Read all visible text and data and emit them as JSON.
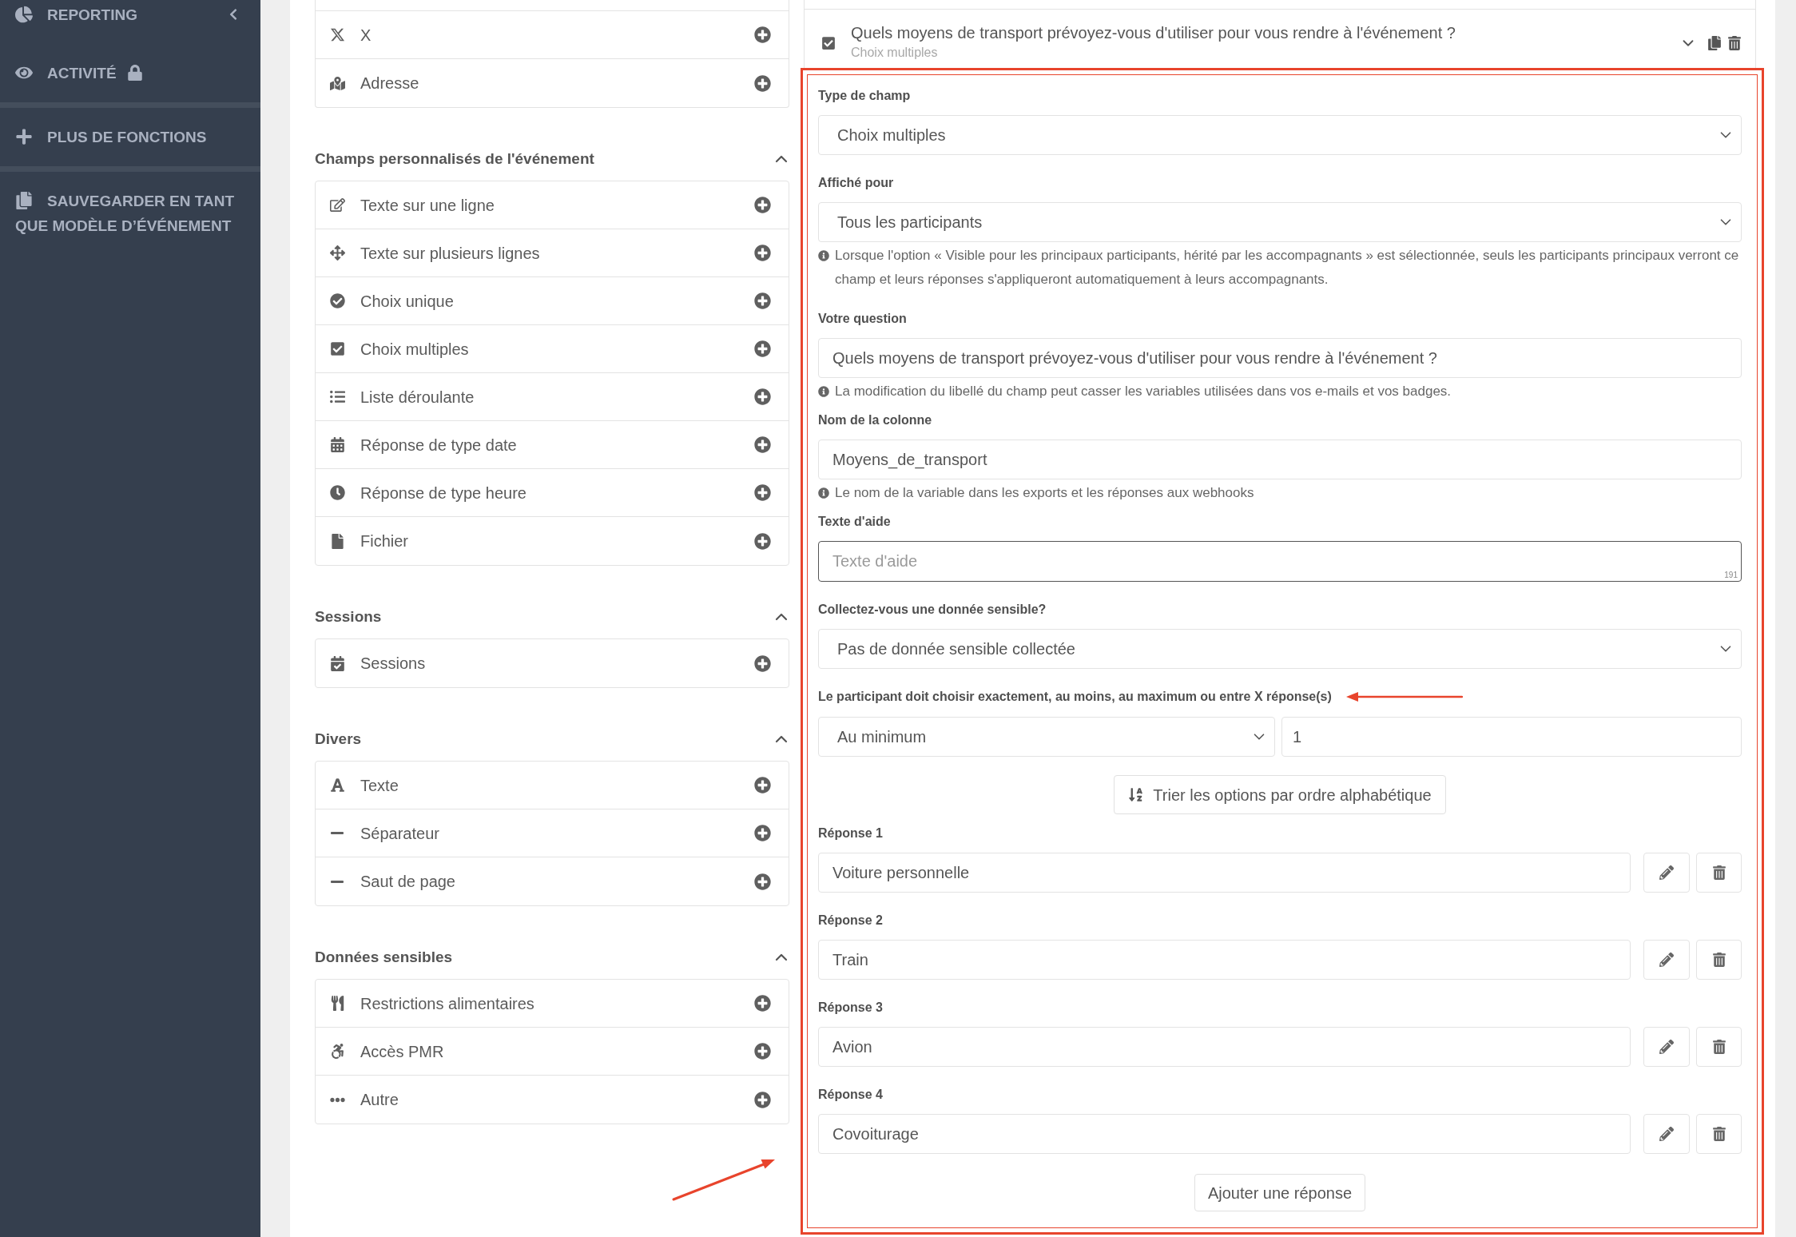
{
  "sidebar": {
    "groups": [
      {
        "items": [
          {
            "label": "REPORTING",
            "kind": "reporting",
            "locked": false
          },
          {
            "label": "ACTIVITÉ",
            "kind": "activity",
            "locked": true
          }
        ]
      },
      {
        "items": [
          {
            "label": "PLUS DE FONCTIONS",
            "kind": "more",
            "locked": false
          }
        ]
      },
      {
        "items": [
          {
            "label": "SAUVEGARDER EN TANT QUE MODÈLE D’ÉVÉNEMENT",
            "kind": "template",
            "locked": false
          }
        ]
      }
    ]
  },
  "palette": {
    "top_rows": [
      {
        "label": "X",
        "kind": "x"
      },
      {
        "label": "Adresse",
        "kind": "address"
      }
    ],
    "sections": [
      {
        "title": "Champs personnalisés de l'événement",
        "expanded": true,
        "rows": [
          {
            "label": "Texte sur une ligne",
            "kind": "textline"
          },
          {
            "label": "Texte sur plusieurs lignes",
            "kind": "textarea"
          },
          {
            "label": "Choix unique",
            "kind": "single"
          },
          {
            "label": "Choix multiples",
            "kind": "multiple"
          },
          {
            "label": "Liste déroulante",
            "kind": "dropdown"
          },
          {
            "label": "Réponse de type date",
            "kind": "date"
          },
          {
            "label": "Réponse de type heure",
            "kind": "time"
          },
          {
            "label": "Fichier",
            "kind": "file"
          }
        ]
      },
      {
        "title": "Sessions",
        "expanded": true,
        "rows": [
          {
            "label": "Sessions",
            "kind": "sessions"
          }
        ]
      },
      {
        "title": "Divers",
        "expanded": true,
        "rows": [
          {
            "label": "Texte",
            "kind": "text"
          },
          {
            "label": "Séparateur",
            "kind": "separator"
          },
          {
            "label": "Saut de page",
            "kind": "pagebreak"
          }
        ]
      },
      {
        "title": "Données sensibles",
        "expanded": true,
        "rows": [
          {
            "label": "Restrictions alimentaires",
            "kind": "diet"
          },
          {
            "label": "Accès PMR",
            "kind": "accessibility"
          },
          {
            "label": "Autre",
            "kind": "other"
          }
        ]
      }
    ]
  },
  "question": {
    "title": "Quels moyens de transport prévoyez-vous d'utiliser pour vous rendre à l'événement ?",
    "type_label": "Choix multiples",
    "kind": "multiple"
  },
  "editor": {
    "fields": [
      {
        "kind": "select",
        "label": "Type de champ",
        "value": "Choix multiples",
        "focused": false,
        "annotated": false
      },
      {
        "kind": "select",
        "label": "Affiché pour",
        "value": "Tous les participants",
        "hint": "Lorsque l'option « Visible pour les principaux participants, hérité par les accompagnants » est sélectionnée, seuls les participants principaux verront ce champ et leurs réponses s'appliqueront automatiquement à leurs accompagnants.",
        "focused": false,
        "annotated": false
      },
      {
        "kind": "input",
        "label": "Votre question",
        "value": "Quels moyens de transport prévoyez-vous d'utiliser pour vous rendre à l'événement ?",
        "hint": "La modification du libellé du champ peut casser les variables utilisées dans vos e-mails et vos badges.",
        "focused": false,
        "annotated": false
      },
      {
        "kind": "input",
        "label": "Nom de la colonne",
        "value": "Moyens_de_transport",
        "hint": "Le nom de la variable dans les exports et les réponses aux webhooks",
        "focused": false,
        "annotated": false
      },
      {
        "kind": "textarea",
        "label": "Texte d'aide",
        "placeholder": "Texte d'aide",
        "counter": "191",
        "focused": true,
        "annotated": false
      },
      {
        "kind": "select",
        "label": "Collectez-vous une donnée sensible?",
        "value": "Pas de donnée sensible collectée",
        "focused": false,
        "annotated": false
      },
      {
        "kind": "range",
        "label": "Le participant doit choisir exactement, au moins, au maximum ou entre X réponse(s)",
        "mode": "Au minimum",
        "count": "1",
        "focused": false,
        "annotated": true
      }
    ],
    "sort_button": "Trier les options par ordre alphabétique",
    "answers": [
      {
        "label": "Réponse 1",
        "value": "Voiture personnelle"
      },
      {
        "label": "Réponse 2",
        "value": "Train"
      },
      {
        "label": "Réponse 3",
        "value": "Avion"
      },
      {
        "label": "Réponse 4",
        "value": "Covoiturage"
      }
    ],
    "add_button": "Ajouter une réponse"
  }
}
